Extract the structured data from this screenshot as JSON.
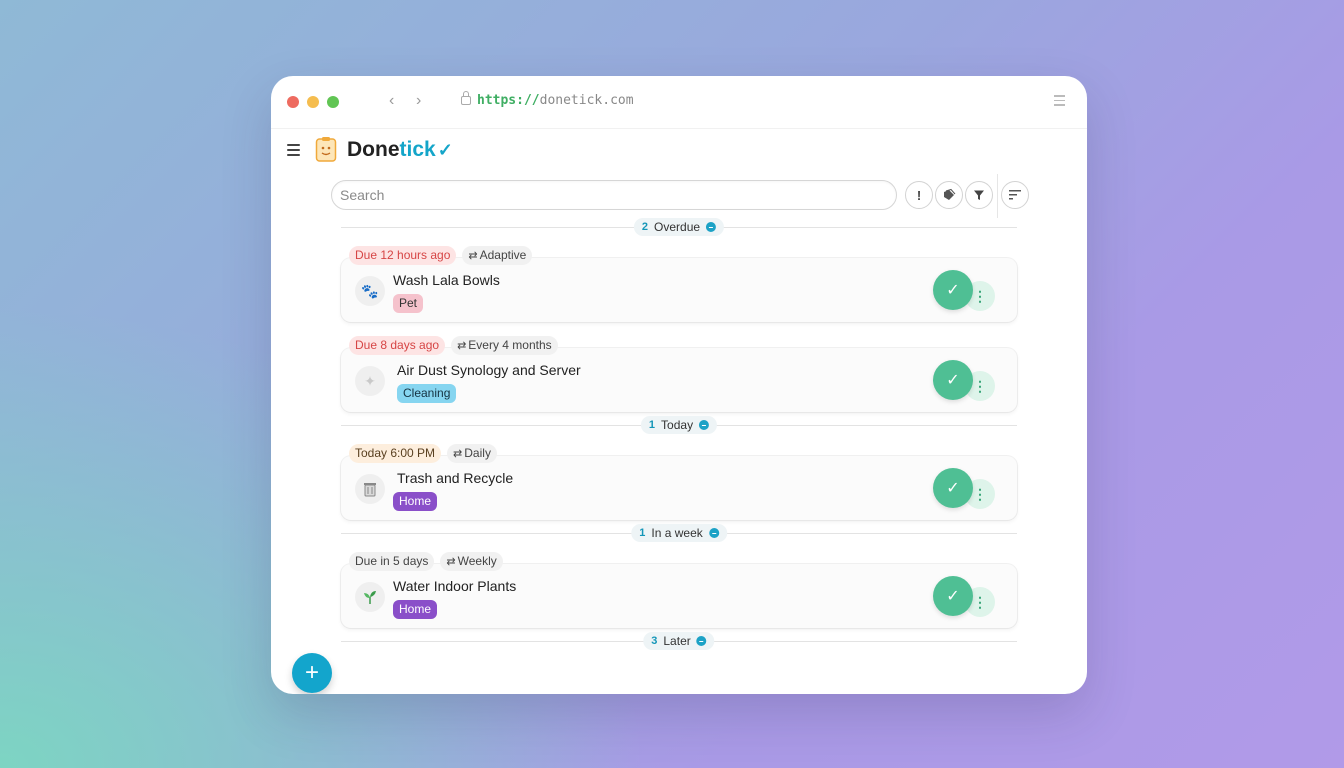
{
  "browser": {
    "url_protocol": "https://",
    "url_host": "donetick.com"
  },
  "app": {
    "brand_first": "Done",
    "brand_second": "tick",
    "brand_check": "✓"
  },
  "search": {
    "placeholder": "Search"
  },
  "toolbar": {
    "priority_icon": "exclamation-icon",
    "tag_icon": "tags-icon",
    "filter_icon": "filter-icon",
    "sort_icon": "sort-icon"
  },
  "groups": [
    {
      "name": "Overdue",
      "count": "2",
      "tasks": [
        {
          "due": "Due 12 hours ago",
          "due_style": "red",
          "frequency": "Adaptive",
          "title": "Wash Lala Bowls",
          "label": "Pet",
          "label_style": "pet",
          "icon": "paw-icon"
        },
        {
          "due": "Due 8 days ago",
          "due_style": "red",
          "frequency": "Every 4 months",
          "title": "Air Dust Synology and Server",
          "label": "Cleaning",
          "label_style": "cleaning",
          "icon": "broom-icon"
        }
      ]
    },
    {
      "name": "Today",
      "count": "1",
      "tasks": [
        {
          "due": "Today 6:00 PM",
          "due_style": "orange",
          "frequency": "Daily",
          "title": "Trash and Recycle",
          "label": "Home",
          "label_style": "home",
          "icon": "trash-icon"
        }
      ]
    },
    {
      "name": "In a week",
      "count": "1",
      "tasks": [
        {
          "due": "Due in 5 days",
          "due_style": "gray",
          "frequency": "Weekly",
          "title": "Water Indoor Plants",
          "label": "Home",
          "label_style": "home",
          "icon": "sprout-icon"
        }
      ]
    },
    {
      "name": "Later",
      "count": "3",
      "tasks": []
    }
  ],
  "colors": {
    "accent": "#14a5c9",
    "done_button": "#4fbf94",
    "due_red": "#d64545",
    "label_home": "#8a4fc9",
    "label_pet": "#f5c2cc",
    "label_cleaning": "#86d5f0"
  },
  "fab_label": "+"
}
